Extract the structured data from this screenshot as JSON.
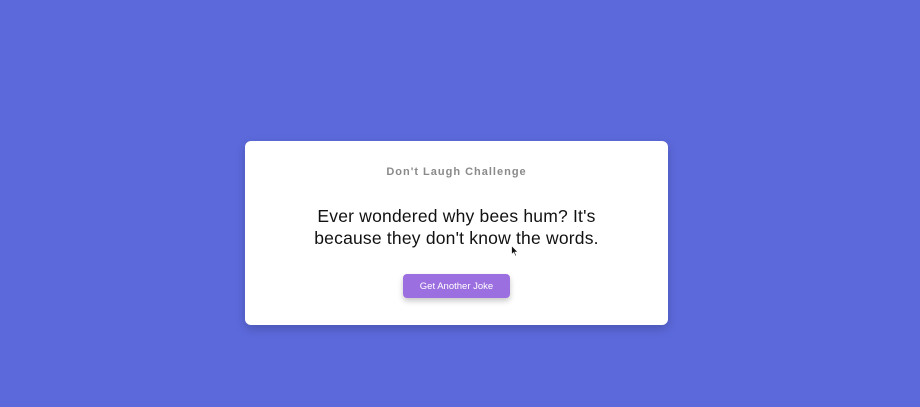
{
  "page": {
    "background_color": "#5c69db"
  },
  "card": {
    "title": "Don't Laugh Challenge",
    "joke_line_1": "Ever wondered why bees hum? It's",
    "joke_line_2": "because they don't know the words.",
    "button_label": "Get Another Joke",
    "button_color": "#9c6fe0"
  },
  "cursor": {
    "icon": "mouse-pointer-icon"
  }
}
